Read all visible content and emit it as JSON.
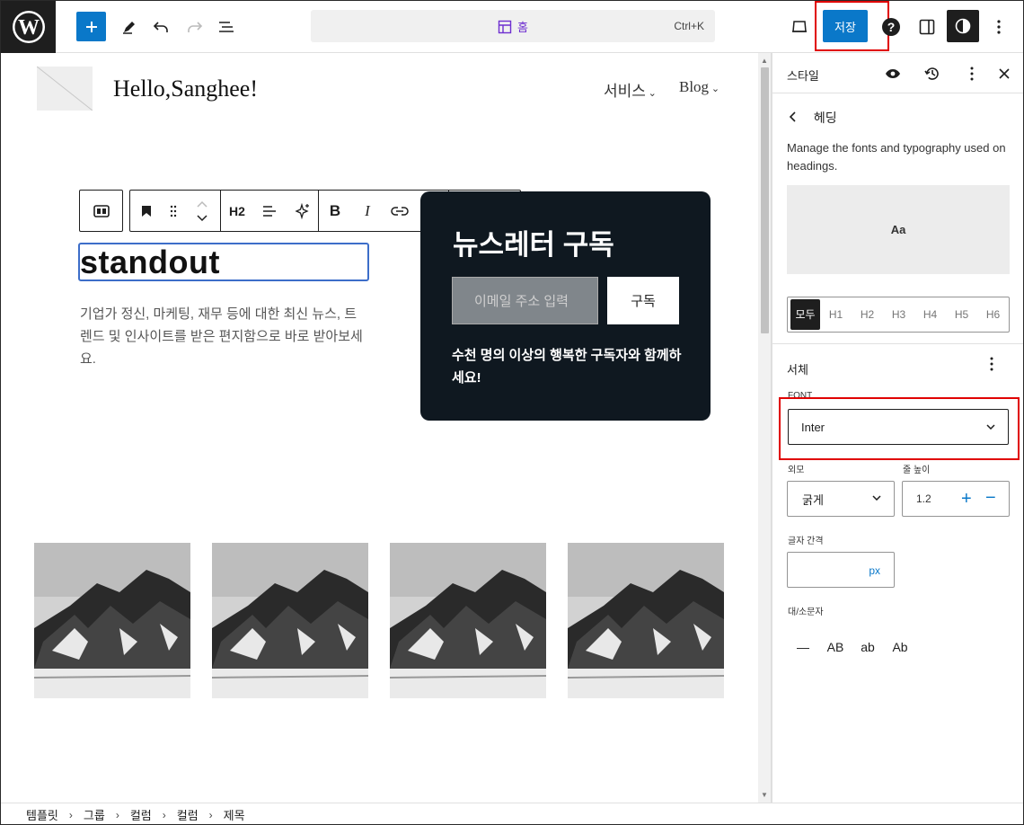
{
  "toolbar": {
    "document_title": "홈",
    "shortcut": "Ctrl+K",
    "save_label": "저장"
  },
  "site": {
    "title": "Hello,Sanghee!",
    "nav": [
      "서비스",
      "Blog"
    ]
  },
  "block_toolbar": {
    "heading_level": "H2"
  },
  "content": {
    "heading": "standout",
    "paragraph": "기업가 정신, 마케팅, 재무 등에 대한 최신 뉴스, 트렌드 및 인사이트를 받은 편지함으로 바로 받아보세요.",
    "newsletter": {
      "title": "뉴스레터 구독",
      "input_placeholder": "이메일 주소 입력",
      "button_label": "구독",
      "note": "수천 명의 이상의 행복한 구독자와 함께하세요!"
    },
    "gallery_count": 4
  },
  "breadcrumbs": [
    "템플릿",
    "그룹",
    "컬럼",
    "컬럼",
    "제목"
  ],
  "sidebar": {
    "title": "스타일",
    "back_label": "헤딩",
    "description": "Manage the fonts and typography used on headings.",
    "preview_text": "Aa",
    "levels": {
      "all": "모두",
      "items": [
        "H1",
        "H2",
        "H3",
        "H4",
        "H5",
        "H6"
      ]
    },
    "typography": {
      "section_title": "서체",
      "font_label": "FONT",
      "font_value": "Inter",
      "appearance_label": "외모",
      "appearance_value": "굵게",
      "line_height_label": "줄 높이",
      "line_height_value": "1.2",
      "letter_spacing_label": "글자 간격",
      "letter_spacing_unit": "px",
      "case_label": "대/소문자",
      "case_options": [
        "—",
        "AB",
        "ab",
        "Ab"
      ]
    }
  },
  "colors": {
    "accent": "#0a78c9",
    "highlight": "#e00000",
    "newsletter_bg": "#0f1820"
  }
}
